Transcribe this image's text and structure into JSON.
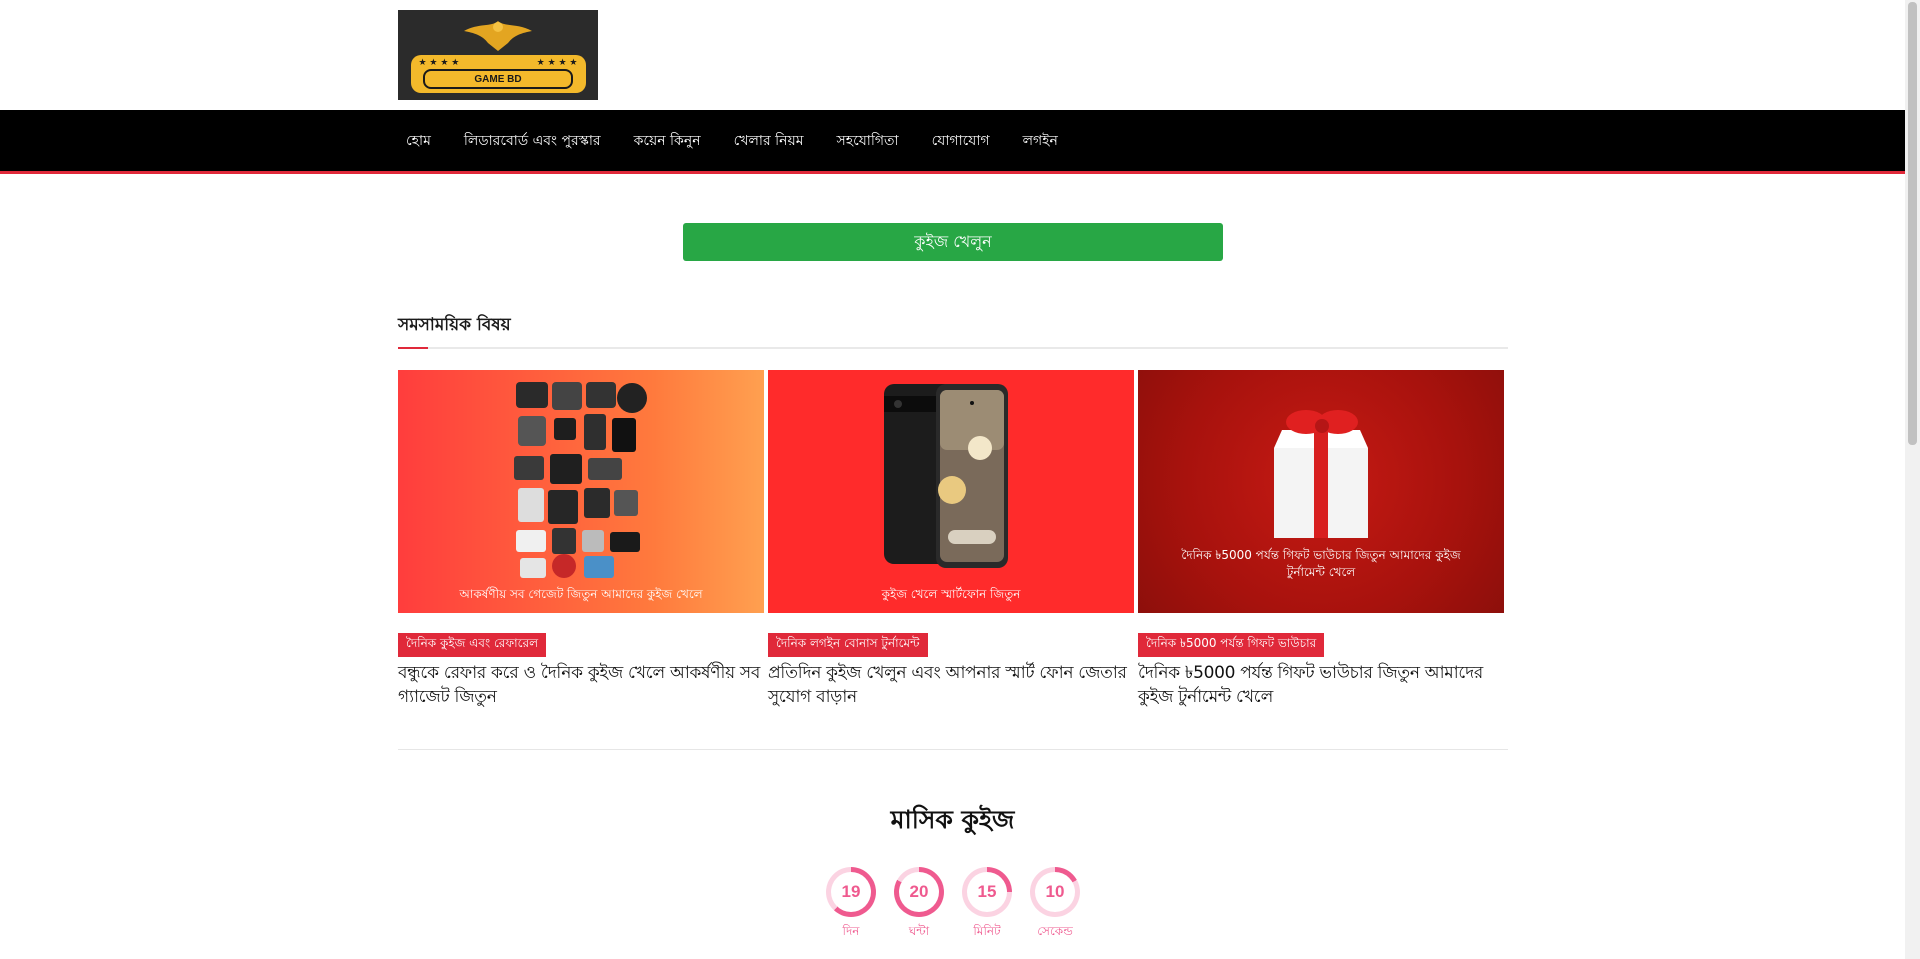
{
  "logo": {
    "text": "GAME BD",
    "stars_left": "★ ★ ★ ★",
    "stars_right": "★ ★ ★ ★"
  },
  "nav": {
    "items": [
      "হোম",
      "লিডারবোর্ড এবং পুরস্কার",
      "কয়েন কিনুন",
      "খেলার নিয়ম",
      "সহযোগিতা",
      "যোগাযোগ",
      "লগইন"
    ]
  },
  "quiz_button": {
    "label": "কুইজ খেলুন"
  },
  "section": {
    "title": "সমসাময়িক বিষয়"
  },
  "cards": [
    {
      "image_caption": "আকর্ষণীয় সব গেজেট জিতুন আমাদের কুইজ খেলে",
      "badge": "দৈনিক কুইজ এবং রেফারেল",
      "title": "বন্ধুকে রেফার করে ও দৈনিক কুইজ খেলে আকর্ষণীয় সব গ্যাজেট জিতুন",
      "bg": "#ff5a3c"
    },
    {
      "image_caption": "কুইজ খেলে স্মার্টফোন জিতুন",
      "badge": "দৈনিক লগইন বোনাস টুর্নামেন্ট",
      "title": "প্রতিদিন কুইজ খেলুন এবং আপনার স্মার্ট ফোন জেতার সুযোগ বাড়ান",
      "bg": "#ff2b2b"
    },
    {
      "image_caption": "দৈনিক ৳5000 পর্যন্ত গিফট ভাউচার জিতুন আমাদের কুইজ টুর্নামেন্ট খেলে",
      "badge": "দৈনিক ৳5000 পর্যন্ত গিফট ভাউচার",
      "title": "দৈনিক ৳5000 পর্যন্ত গিফট ভাউচার জিতুন আমাদের কুইজ টুর্নামেন্ট খেলে",
      "bg": "#b3130f"
    }
  ],
  "monthly": {
    "title": "মাসিক কুইজ",
    "timer": [
      {
        "value": "19",
        "label": "দিন",
        "fraction": 0.62
      },
      {
        "value": "20",
        "label": "ঘন্টা",
        "fraction": 0.83
      },
      {
        "value": "15",
        "label": "মিনিট",
        "fraction": 0.25
      },
      {
        "value": "10",
        "label": "সেকেন্ড",
        "fraction": 0.17
      }
    ]
  },
  "colors": {
    "accent": "#e0293a",
    "button_green": "#28a745",
    "timer_pink": "#ef5a8f",
    "ring_track": "#fbd3e2"
  }
}
